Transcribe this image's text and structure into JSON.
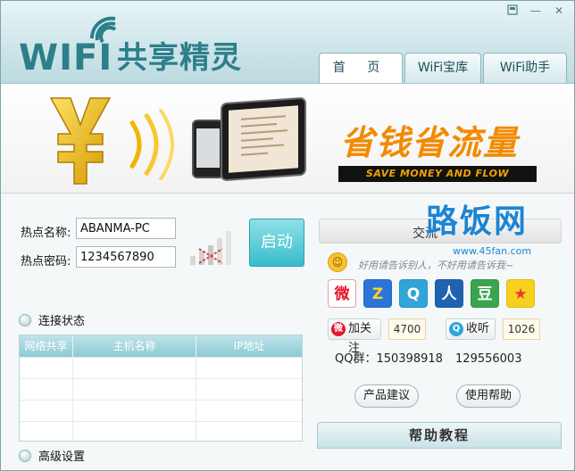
{
  "app": {
    "logo_text": "WIFI",
    "logo_cn": "共享精灵"
  },
  "window_controls": {
    "settings_icon": "gear-icon",
    "minimize": "—",
    "close": "✕"
  },
  "tabs": [
    {
      "label": "首  页",
      "active": true
    },
    {
      "label": "WiFi宝库",
      "active": false
    },
    {
      "label": "WiFi助手",
      "active": false
    }
  ],
  "banner": {
    "slogan_cn": "省钱省流量",
    "slogan_en": "SAVE MONEY AND FLOW"
  },
  "hotspot": {
    "name_label": "热点名称:",
    "name_value": "ABANMA-PC",
    "password_label": "热点密码:",
    "password_value": "1234567890",
    "start_label": "启动"
  },
  "connection": {
    "section_label": "连接状态",
    "columns": [
      "网络共享",
      "主机名称",
      "IP地址"
    ],
    "rows": [
      [
        "",
        "",
        ""
      ],
      [
        "",
        "",
        ""
      ],
      [
        "",
        "",
        ""
      ],
      [
        "",
        "",
        ""
      ]
    ]
  },
  "advanced": {
    "section_label": "高级设置"
  },
  "right_panel": {
    "exchange_label": "交流",
    "watermark_big": "路饭网",
    "watermark_small": "www.45fan.com",
    "handwriting": "好用请告诉别人，不好用请告诉我~",
    "share_icons": [
      {
        "name": "weibo-icon",
        "glyph": "微",
        "color": "#e6162d"
      },
      {
        "name": "qzone-icon",
        "glyph": "Z",
        "color": "#2b74d9"
      },
      {
        "name": "tencent-weibo-icon",
        "glyph": "Q",
        "color": "#2fa5d8"
      },
      {
        "name": "renren-icon",
        "glyph": "人",
        "color": "#1f62b0"
      },
      {
        "name": "douban-icon",
        "glyph": "豆",
        "color": "#3aa54d"
      },
      {
        "name": "qq-space-star-icon",
        "glyph": "★",
        "color": "#f39c12"
      }
    ],
    "follow_label": "加关注",
    "follow_count": "4700",
    "listen_label": "收听",
    "listen_count": "1026",
    "qq_group": "QQ群：150398918  129556003",
    "suggest_label": "产品建议",
    "help_label": "使用帮助",
    "tutorial_label": "帮助教程"
  }
}
